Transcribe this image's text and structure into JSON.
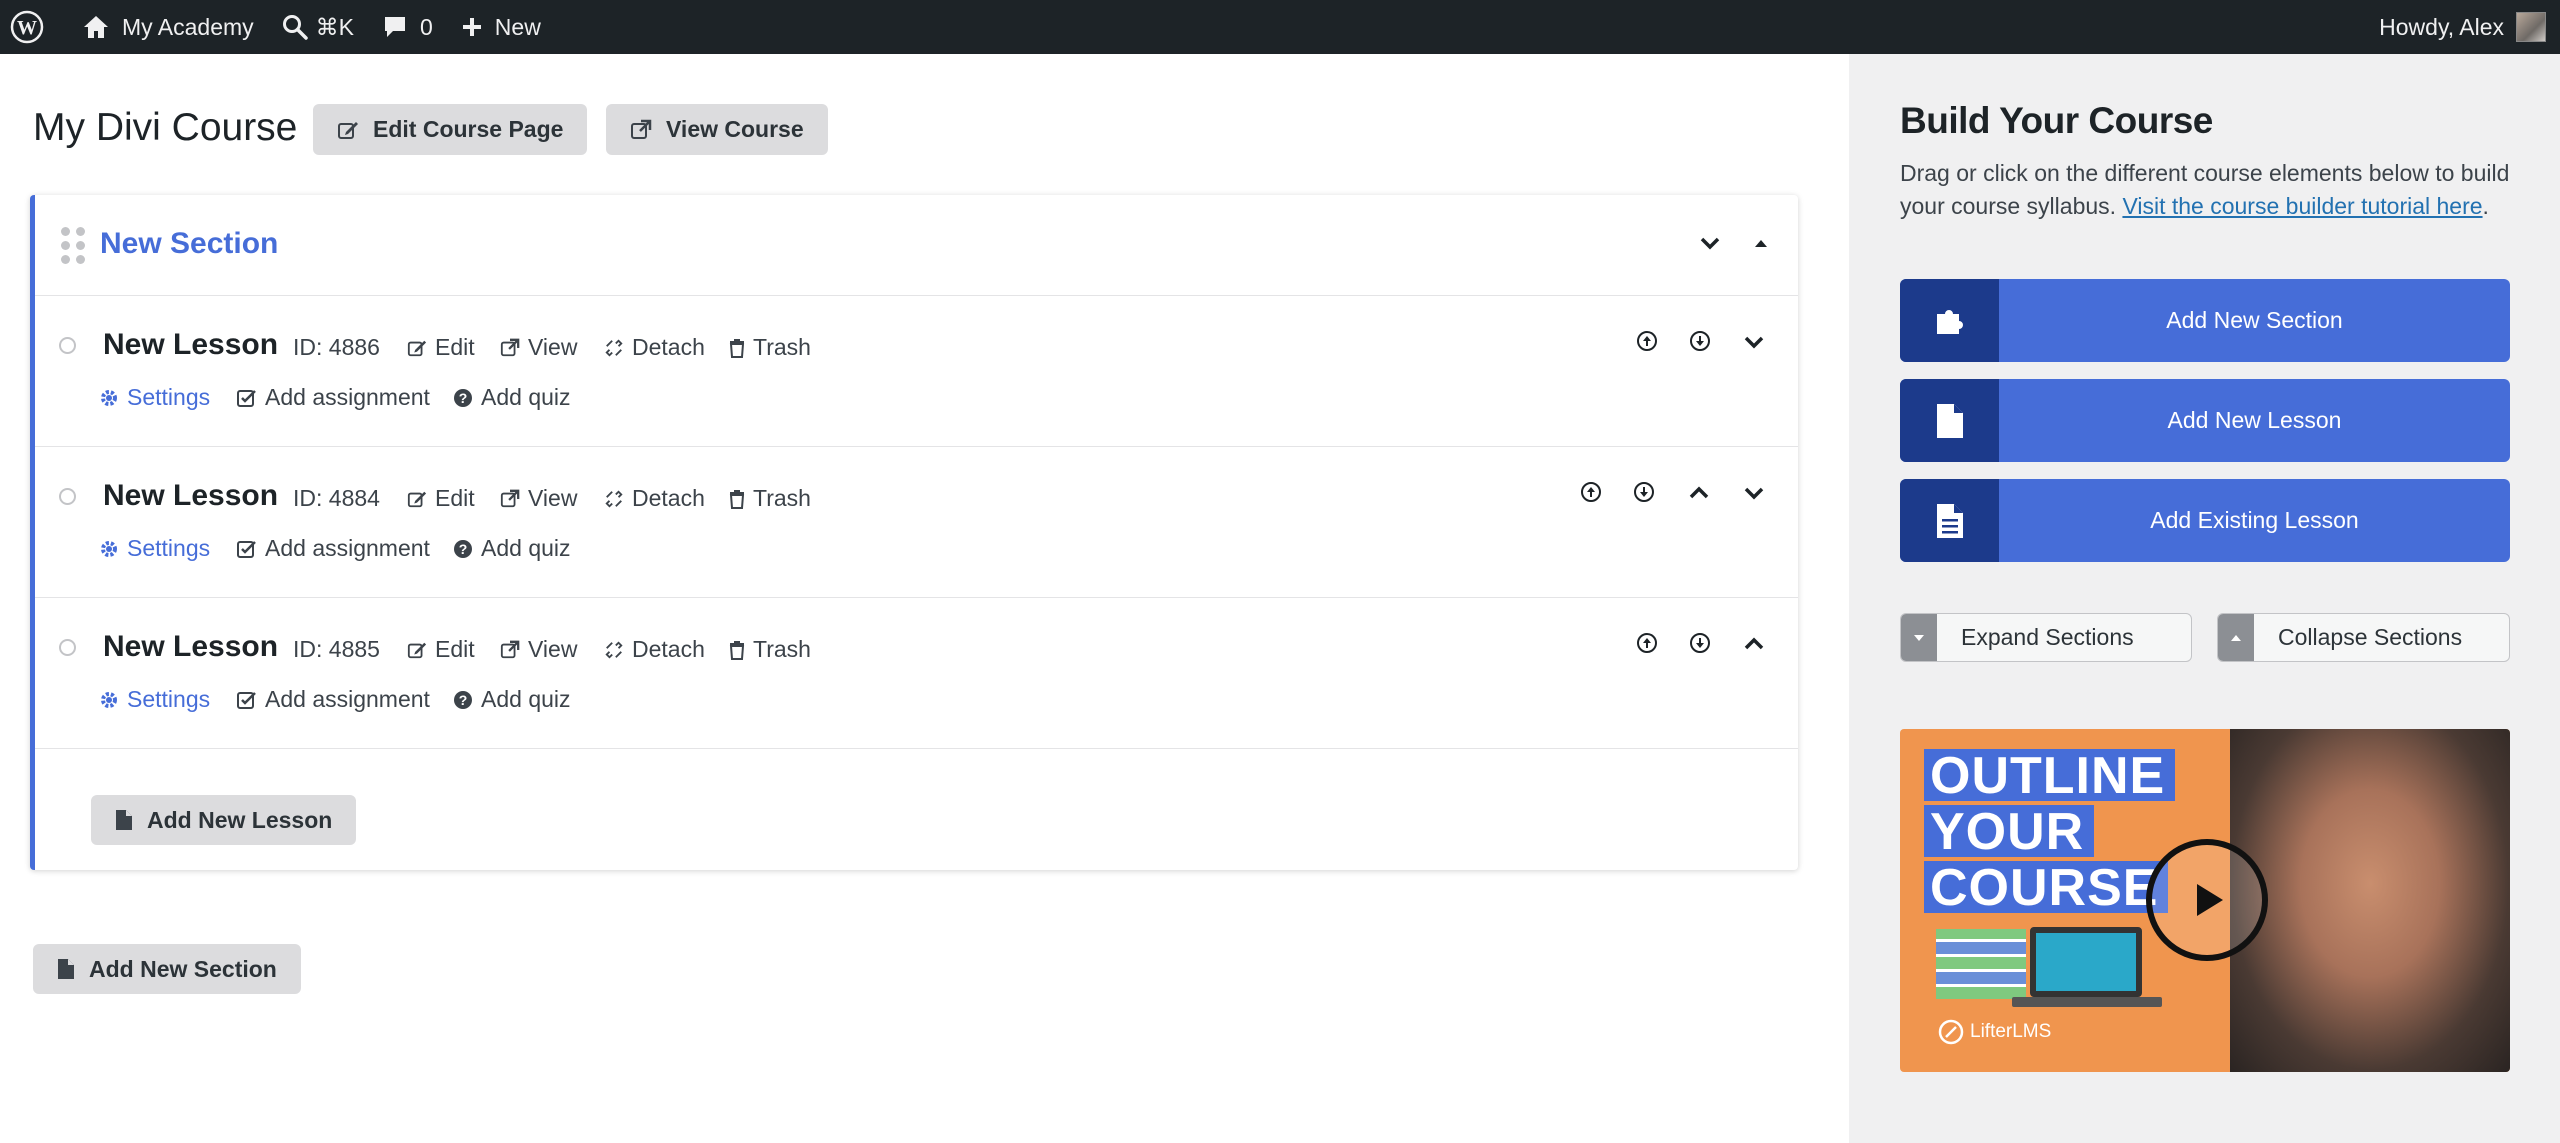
{
  "adminbar": {
    "site_name": "My Academy",
    "search_shortcut": "⌘K",
    "comments_count": "0",
    "new_label": "New",
    "greeting": "Howdy, Alex"
  },
  "header": {
    "title": "My Divi Course",
    "edit_course_page": "Edit Course Page",
    "view_course": "View Course"
  },
  "section": {
    "title": "New Section",
    "add_lesson_label": "Add New Lesson",
    "lessons": [
      {
        "title": "New Lesson",
        "id": "ID: 4886",
        "edit": "Edit",
        "view": "View",
        "detach": "Detach",
        "trash": "Trash",
        "settings": "Settings",
        "add_assignment": "Add assignment",
        "add_quiz": "Add quiz"
      },
      {
        "title": "New Lesson",
        "id": "ID: 4884",
        "edit": "Edit",
        "view": "View",
        "detach": "Detach",
        "trash": "Trash",
        "settings": "Settings",
        "add_assignment": "Add assignment",
        "add_quiz": "Add quiz"
      },
      {
        "title": "New Lesson",
        "id": "ID: 4885",
        "edit": "Edit",
        "view": "View",
        "detach": "Detach",
        "trash": "Trash",
        "settings": "Settings",
        "add_assignment": "Add assignment",
        "add_quiz": "Add quiz"
      }
    ]
  },
  "add_new_section_bottom": "Add New Section",
  "sidebar": {
    "title": "Build Your Course",
    "description": "Drag or click on the different course elements below to build your course syllabus. ",
    "tutorial_link": "Visit the course builder tutorial here",
    "period": ".",
    "add_new_section": "Add New Section",
    "add_new_lesson": "Add New Lesson",
    "add_existing_lesson": "Add Existing Lesson",
    "expand_sections": "Expand Sections",
    "collapse_sections": "Collapse Sections",
    "video": {
      "line1": "OUTLINE",
      "line2": "YOUR",
      "line3": "COURSE",
      "brand": "LifterLMS"
    }
  },
  "colors": {
    "accent": "#466dd8",
    "accent_dark": "#1c3a8b",
    "adminbar_bg": "#1d2327",
    "sidebar_bg": "#f0f0f1",
    "video_bg": "#f0954e"
  }
}
